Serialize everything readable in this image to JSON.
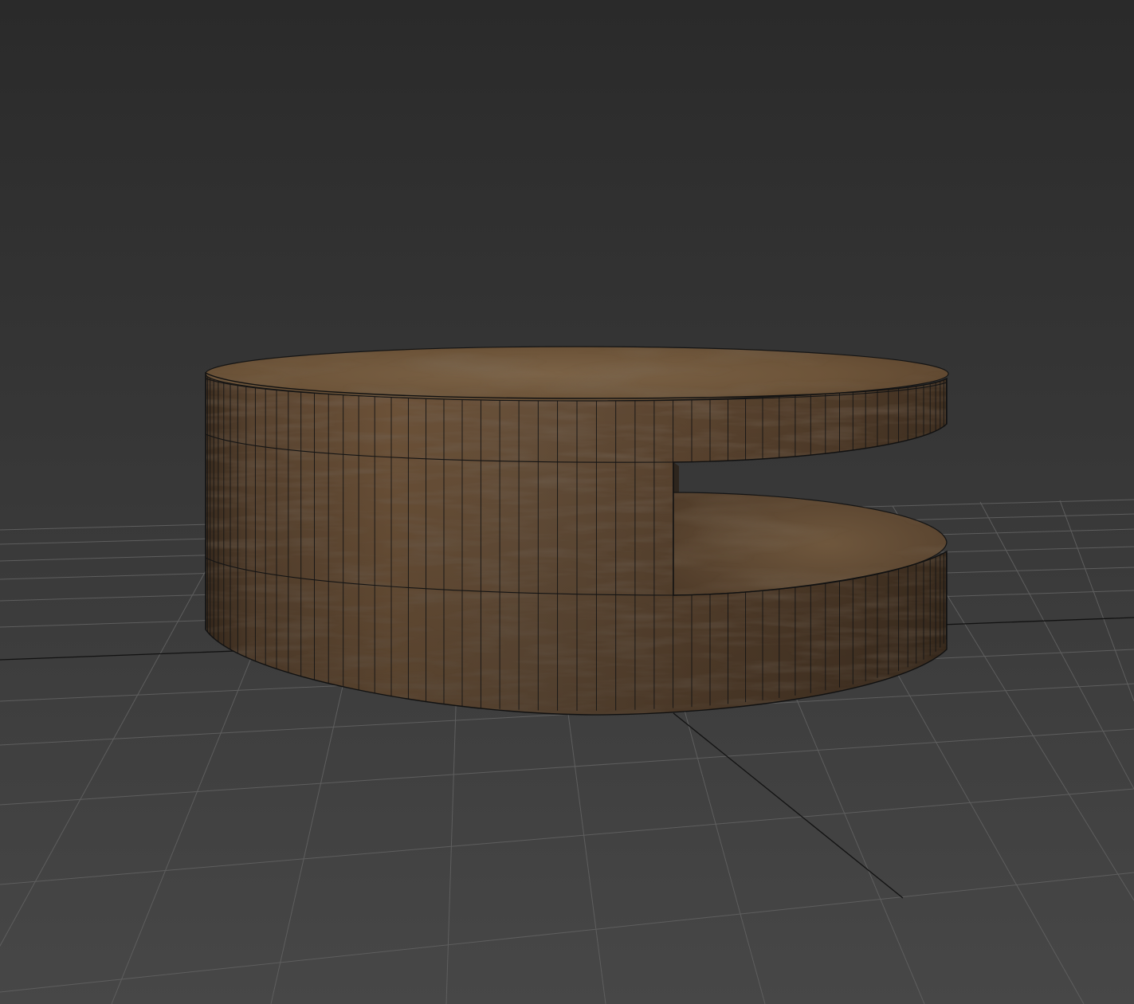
{
  "viewport": {
    "background_top": "#2a2a2a",
    "background_bottom": "#474747",
    "grid_line_color": "#5e5e5e",
    "grid_axis_color": "#121212",
    "shading": "textured-wireframe"
  },
  "object": {
    "type": "round-coffee-table",
    "material": "wood",
    "material_colors": {
      "light": "#7a6043",
      "mid": "#5e4631",
      "dark": "#3d2c1e",
      "grain": "#2f2218"
    },
    "wire_color": "#141414",
    "shelf_cutout": true
  }
}
